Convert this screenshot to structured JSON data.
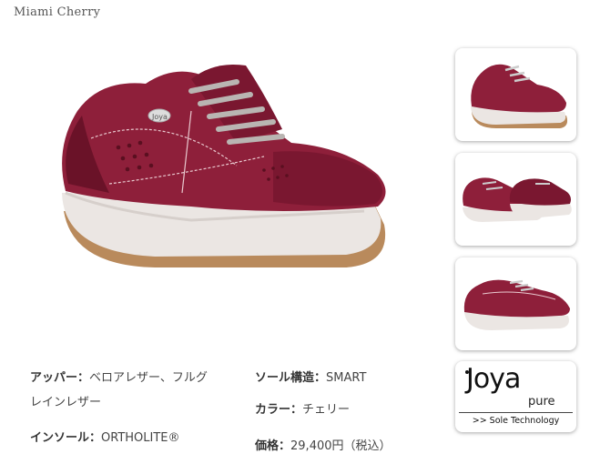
{
  "product": {
    "title": "Miami Cherry"
  },
  "images": {
    "main_alt": "main-shoe-image",
    "thumbnails": [
      "thumbnail-side-view",
      "thumbnail-pair-view",
      "thumbnail-outer-side-view"
    ]
  },
  "colors": {
    "shoe": "#8e1f3a",
    "shoe_dark": "#6a1228",
    "sole": "#ebe6e3",
    "outsole": "#b98a5c",
    "laces": "#b9b5b2"
  },
  "specs": {
    "upper_key": "アッパー：",
    "upper_val_1": "ベロアレザー、フルグ",
    "upper_val_2": "レインレザー",
    "insole_key": "インソール：",
    "insole_val": "ORTHOLITE®",
    "sole_key": "ソール構造：",
    "sole_val": "SMART",
    "color_key": "カラー：",
    "color_val": "チェリー",
    "price_key": "価格：",
    "price_val": "29,400円（税込）"
  },
  "logo": {
    "word": "Joya",
    "sub": "pure",
    "tagline": ">> Sole Technology"
  }
}
